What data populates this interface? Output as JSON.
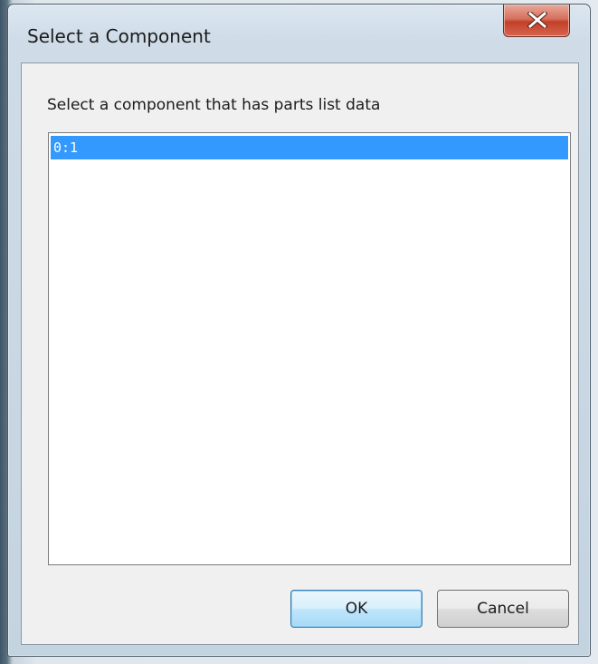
{
  "dialog": {
    "title": "Select a Component",
    "prompt": "Select a component that has parts list data",
    "list_items": [
      {
        "label": "0:1",
        "selected": true
      }
    ],
    "ok_label": "OK",
    "cancel_label": "Cancel"
  },
  "icons": {
    "close": "close-icon"
  },
  "colors": {
    "selection": "#3399ff",
    "close_button": "#c7432e"
  }
}
